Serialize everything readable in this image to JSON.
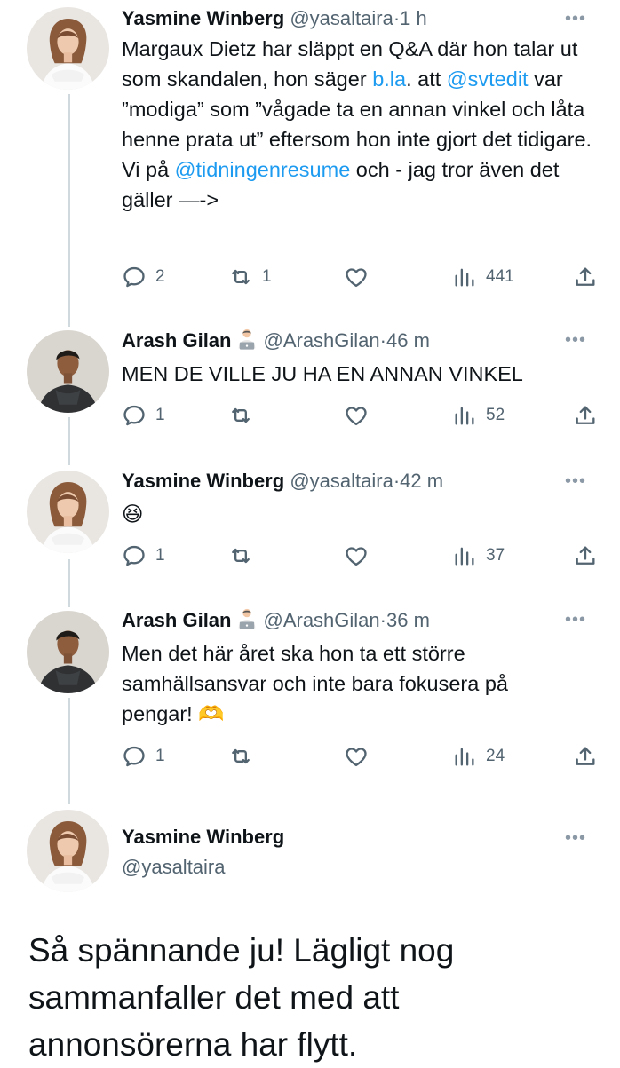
{
  "tweets": [
    {
      "name": "Yasmine Winberg",
      "handle": "@yasaltaira",
      "time": "1 h",
      "text_parts": {
        "p1": "Margaux Dietz har släppt en Q&A där hon talar ut som skandalen, hon säger ",
        "link1": "b.la",
        "p2": ". att ",
        "link2": "@svtedit",
        "p3": " var ”modiga” som ”vågade ta en annan vinkel och låta henne prata ut” eftersom hon inte gjort det tidigare. Vi på ",
        "link3": "@tidningenresume",
        "p4": " och - jag tror även det gäller —->"
      },
      "replies": "2",
      "retweets": "1",
      "views": "441"
    },
    {
      "name": "Arash Gilan",
      "handle": "@ArashGilan",
      "time": "46 m",
      "text": "MEN DE VILLE JU HA EN ANNAN VINKEL",
      "replies": "1",
      "views": "52"
    },
    {
      "name": "Yasmine Winberg",
      "handle": "@yasaltaira",
      "time": "42 m",
      "text": "😆",
      "replies": "1",
      "views": "37"
    },
    {
      "name": "Arash Gilan",
      "handle": "@ArashGilan",
      "time": "36 m",
      "text": "Men det här året ska hon ta ett större samhällsansvar och inte bara fokusera på pengar! 🫶",
      "replies": "1",
      "views": "24"
    }
  ],
  "main_tweet": {
    "name": "Yasmine Winberg",
    "handle": "@yasaltaira",
    "text": "Så spännande ju! Lägligt nog sammanfaller det med att annonsörerna har flytt."
  },
  "separator": "·",
  "more_label": "•••",
  "icons": {
    "reply": "reply-icon",
    "retweet": "retweet-icon",
    "like": "like-icon",
    "views": "views-icon",
    "share": "share-icon",
    "more": "more-icon",
    "person": "person-at-laptop-emoji"
  },
  "colors": {
    "link": "#1d9bf0",
    "secondary_text": "#536471",
    "thread_line": "#cfd9de"
  }
}
